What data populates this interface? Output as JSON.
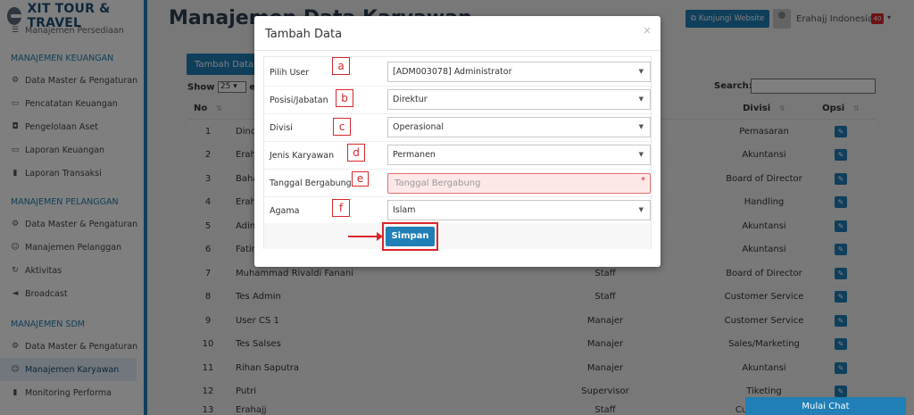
{
  "sidebar": {
    "brand": "XIT TOUR & TRAVEL",
    "partial_item": "Manajemen Persediaan",
    "sections": [
      {
        "title": "MANAJEMEN KEUANGAN",
        "items": [
          {
            "label": "Data Master & Pengaturan",
            "icon": "gears-icon"
          },
          {
            "label": "Pencatatan Keuangan",
            "icon": "money-icon"
          },
          {
            "label": "Pengelolaan Aset",
            "icon": "car-icon"
          },
          {
            "label": "Laporan Keuangan",
            "icon": "money-icon"
          },
          {
            "label": "Laporan Transaksi",
            "icon": "book-icon"
          }
        ]
      },
      {
        "title": "MANAJEMEN PELANGGAN",
        "items": [
          {
            "label": "Data Master & Pengaturan",
            "icon": "gears-icon"
          },
          {
            "label": "Manajemen Pelanggan",
            "icon": "users-icon"
          },
          {
            "label": "Aktivitas",
            "icon": "refresh-icon"
          },
          {
            "label": "Broadcast",
            "icon": "bullhorn-icon"
          }
        ]
      },
      {
        "title": "MANAJEMEN SDM",
        "items": [
          {
            "label": "Data Master & Pengaturan",
            "icon": "gears-icon"
          },
          {
            "label": "Manajemen Karyawan",
            "icon": "users-icon",
            "active": true
          },
          {
            "label": "Monitoring Performa",
            "icon": "book-icon"
          }
        ]
      }
    ]
  },
  "header": {
    "title": "Manajemen Data Karyawan",
    "visit_label": "Kunjungi Website",
    "user_name": "Erahajj Indonesia",
    "notif_count": "40"
  },
  "content": {
    "add_button": "Tambah Data",
    "show_label": "Show",
    "show_value": "25",
    "entries_label": "entries",
    "search_label": "Search:",
    "columns": {
      "no": "No",
      "divisi": "Divisi",
      "opsi": "Opsi"
    },
    "rows": [
      {
        "no": "1",
        "name": "Dind",
        "position": "",
        "division": "Pemasaran"
      },
      {
        "no": "2",
        "name": "Erah",
        "position": "",
        "division": "Akuntansi"
      },
      {
        "no": "3",
        "name": "Baha",
        "position": "",
        "division": "Board of Director"
      },
      {
        "no": "4",
        "name": "Erah",
        "position": "",
        "division": "Handling"
      },
      {
        "no": "5",
        "name": "Adin",
        "position": "",
        "division": "Akuntansi"
      },
      {
        "no": "6",
        "name": "Fatir",
        "position": "",
        "division": "Akuntansi"
      },
      {
        "no": "7",
        "name": "Muhammad Rivaldi Fanani",
        "position": "Staff",
        "division": "Board of Director"
      },
      {
        "no": "8",
        "name": "Tes Admin",
        "position": "Staff",
        "division": "Customer Service"
      },
      {
        "no": "9",
        "name": "User CS 1",
        "position": "Manajer",
        "division": "Customer Service"
      },
      {
        "no": "10",
        "name": "Tes Salses",
        "position": "Manajer",
        "division": "Sales/Marketing"
      },
      {
        "no": "11",
        "name": "Rihan Saputra",
        "position": "Manajer",
        "division": "Akuntansi"
      },
      {
        "no": "12",
        "name": "Putri",
        "position": "Supervisor",
        "division": "Tiketing"
      },
      {
        "no": "13",
        "name": "Erahajj",
        "position": "Staff",
        "division": "Customer Se"
      }
    ]
  },
  "chat": {
    "label": "Mulai Chat"
  },
  "modal": {
    "title": "Tambah Data",
    "close": "×",
    "fields": [
      {
        "label": "Pilih User",
        "value": "[ADM003078] Administrator",
        "callout": "a"
      },
      {
        "label": "Posisi/Jabatan",
        "value": "Direktur",
        "callout": "b"
      },
      {
        "label": "Divisi",
        "value": "Operasional",
        "callout": "c"
      },
      {
        "label": "Jenis Karyawan",
        "value": "Permanen",
        "callout": "d"
      },
      {
        "label": "Tanggal Bergabung",
        "placeholder": "Tanggal Bergabung",
        "callout": "e"
      },
      {
        "label": "Agama",
        "value": "Islam",
        "callout": "f"
      }
    ],
    "save_label": "Simpan"
  },
  "colors": {
    "primary": "#1f7fb6",
    "annotation": "#d9262b",
    "error_bg": "#fde8e8"
  }
}
